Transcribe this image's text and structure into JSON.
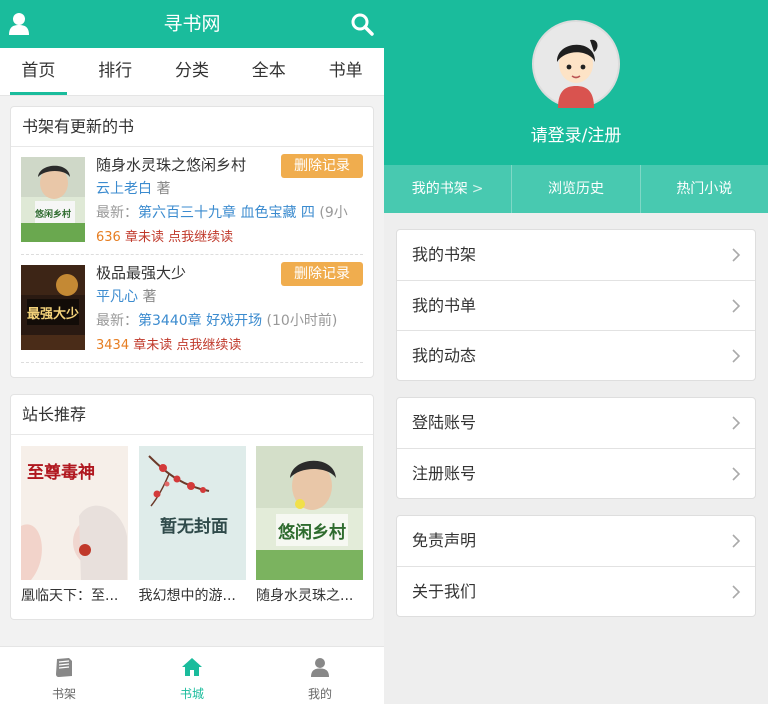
{
  "left": {
    "app_title": "寻书网",
    "tabs": [
      "首页",
      "排行",
      "分类",
      "全本",
      "书单"
    ],
    "active_tab": 0,
    "shelf": {
      "heading": "书架有更新的书",
      "books": [
        {
          "title": "随身水灵珠之悠闲乡村",
          "author": "云上老白",
          "author_suffix": "著",
          "latest_label": "最新：",
          "latest_chapter": "第六百三十九章 血色宝藏 四",
          "latest_time": "(9小",
          "unread_count": "636",
          "unread_text": "章未读 点我继续读",
          "delete_label": "删除记录",
          "cover_text": "悠闲乡村"
        },
        {
          "title": "极品最强大少",
          "author": "平凡心",
          "author_suffix": "著",
          "latest_label": "最新：",
          "latest_chapter": "第3440章 好戏开场",
          "latest_time": "(10小时前)",
          "unread_count": "3434",
          "unread_text": "章未读 点我继续读",
          "delete_label": "删除记录",
          "cover_text": "最强大少"
        }
      ]
    },
    "recommend": {
      "heading": "站长推荐",
      "books": [
        {
          "title": "凰临天下：至...",
          "cover_text": "至尊毒神"
        },
        {
          "title": "我幻想中的游...",
          "cover_text": "暂无封面"
        },
        {
          "title": "随身水灵珠之...",
          "cover_text": "悠闲乡村"
        }
      ]
    },
    "bottom_nav": [
      "书架",
      "书城",
      "我的"
    ],
    "bottom_active": 1
  },
  "right": {
    "login_text": "请登录/注册",
    "quick_links": [
      {
        "label": "我的书架",
        "chevron": ">"
      },
      {
        "label": "浏览历史",
        "chevron": ""
      },
      {
        "label": "热门小说",
        "chevron": ""
      }
    ],
    "menu_groups": [
      [
        "我的书架",
        "我的书单",
        "我的动态"
      ],
      [
        "登陆账号",
        "注册账号"
      ],
      [
        "免责声明",
        "关于我们"
      ]
    ]
  },
  "colors": {
    "brand": "#1abc9c",
    "quick_bar": "#48c9b0",
    "delete_button": "#f0ad4e",
    "link_blue": "#3b8bcf",
    "unread_orange": "#e67e22",
    "unread_red": "#c0392b"
  }
}
